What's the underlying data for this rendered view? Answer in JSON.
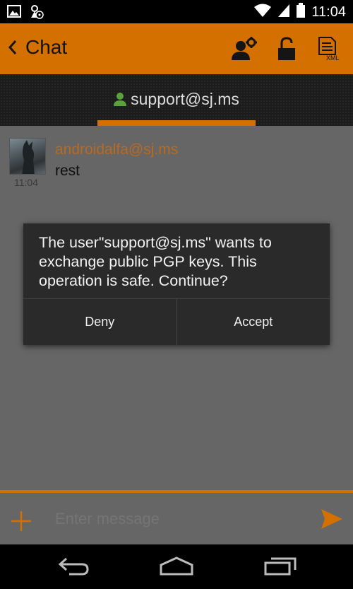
{
  "status_bar": {
    "time": "11:04",
    "icons": [
      "image-icon",
      "media-icon",
      "wifi-icon",
      "signal-icon",
      "battery-icon"
    ]
  },
  "action_bar": {
    "title": "Chat",
    "back_icon": "chevron-left-icon",
    "icons": [
      "contact-settings-icon",
      "unlock-icon",
      "xml-icon"
    ],
    "xml_badge": "XML",
    "accent_color": "#d37000"
  },
  "tab": {
    "label": "support@sj.ms",
    "icon": "person-icon"
  },
  "messages": [
    {
      "sender": "androidalfa@sj.ms",
      "text": "rest",
      "time": "11:04"
    }
  ],
  "dialog": {
    "message": "The user\"support@sj.ms\" wants to exchange public PGP keys. This operation is safe. Continue?",
    "buttons": {
      "deny": "Deny",
      "accept": "Accept"
    }
  },
  "input": {
    "placeholder": "Enter message",
    "value": ""
  },
  "nav": [
    "back-icon",
    "home-icon",
    "recents-icon"
  ]
}
